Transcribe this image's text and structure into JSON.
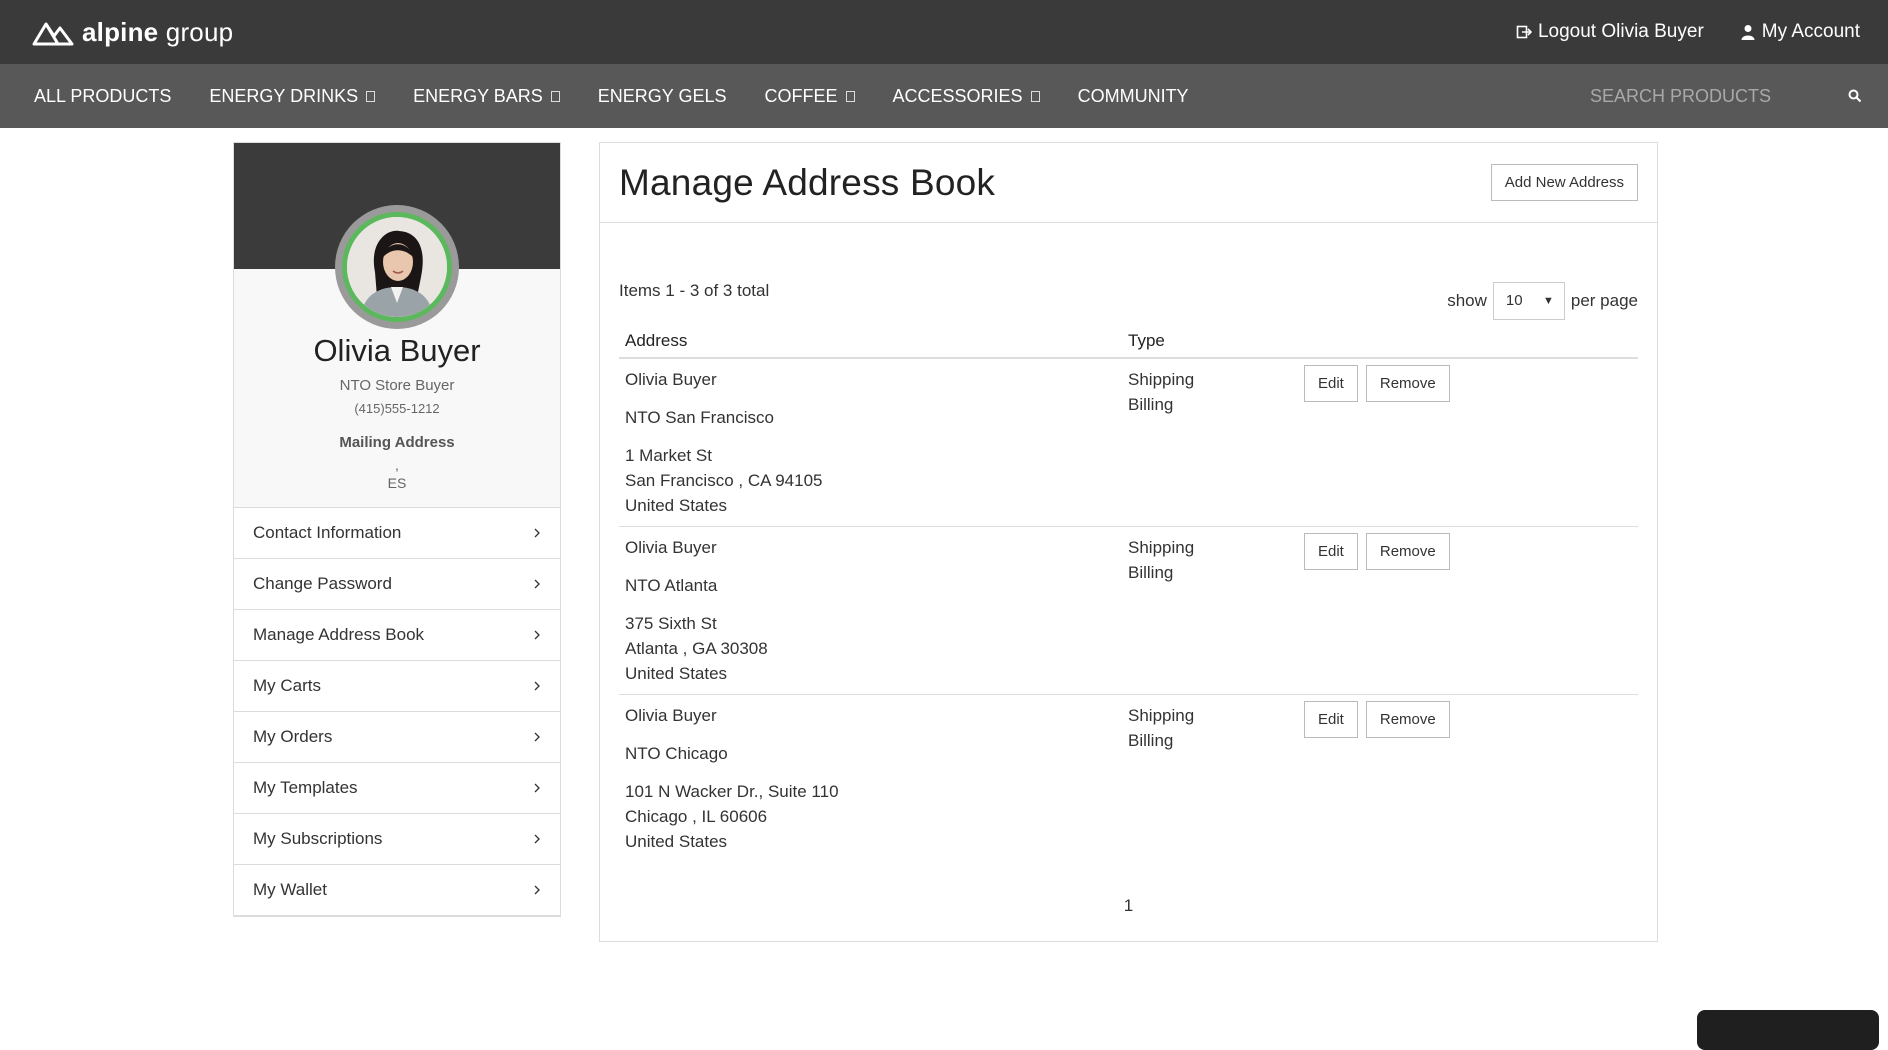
{
  "brand": {
    "bold": "alpine",
    "light": "group"
  },
  "top_links": {
    "logout": "Logout Olivia Buyer",
    "account": "My Account"
  },
  "nav": {
    "items": [
      "ALL PRODUCTS",
      "ENERGY DRINKS",
      "ENERGY BARS",
      "ENERGY GELS",
      "COFFEE",
      "ACCESSORIES",
      "COMMUNITY"
    ],
    "has_caret": [
      false,
      true,
      true,
      false,
      true,
      true,
      false
    ],
    "search_placeholder": "SEARCH PRODUCTS"
  },
  "profile": {
    "name": "Olivia Buyer",
    "title": "NTO Store Buyer",
    "phone": "(415)555-1212",
    "mailing_label": "Mailing Address",
    "comma": ",",
    "country": "ES"
  },
  "side_menu": [
    "Contact Information",
    "Change Password",
    "Manage Address Book",
    "My Carts",
    "My Orders",
    "My Templates",
    "My Subscriptions",
    "My Wallet"
  ],
  "main": {
    "title": "Manage Address Book",
    "add_button": "Add New Address",
    "items_count": "Items 1 - 3 of 3 total",
    "show_label": "show",
    "per_page_value": "10",
    "per_page_label": "per page",
    "col_address": "Address",
    "col_type": "Type",
    "edit_label": "Edit",
    "remove_label": "Remove",
    "page_number": "1"
  },
  "addresses": [
    {
      "name": "Olivia  Buyer",
      "company": "NTO San Francisco",
      "street": "1 Market St",
      "city_line": "San Francisco , CA  94105",
      "country": "United States",
      "types": [
        "Shipping",
        "Billing"
      ]
    },
    {
      "name": "Olivia  Buyer",
      "company": "NTO Atlanta",
      "street": "375 Sixth St",
      "city_line": "Atlanta , GA  30308",
      "country": "United States",
      "types": [
        "Shipping",
        "Billing"
      ]
    },
    {
      "name": "Olivia  Buyer",
      "company": "NTO Chicago",
      "street": "101 N Wacker Dr., Suite 110",
      "city_line": "Chicago , IL  60606",
      "country": "United States",
      "types": [
        "Shipping",
        "Billing"
      ]
    }
  ],
  "colors": {
    "topbar": "#3a3a3a",
    "navbar": "#585858",
    "avatar_ring": "#5cb85c"
  }
}
